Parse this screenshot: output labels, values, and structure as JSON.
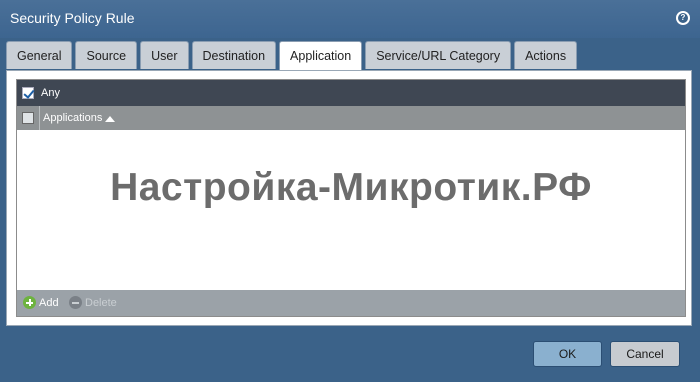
{
  "dialog": {
    "title": "Security Policy Rule",
    "help_icon": "help-icon"
  },
  "tabs": [
    {
      "label": "General"
    },
    {
      "label": "Source"
    },
    {
      "label": "User"
    },
    {
      "label": "Destination"
    },
    {
      "label": "Application",
      "active": true
    },
    {
      "label": "Service/URL Category"
    },
    {
      "label": "Actions"
    }
  ],
  "application": {
    "any_label": "Any",
    "any_checked": true,
    "column_header": "Applications",
    "rows": [],
    "add_label": "Add",
    "delete_label": "Delete"
  },
  "watermark": "Настройка-Микротик.РФ",
  "buttons": {
    "ok": "OK",
    "cancel": "Cancel"
  }
}
